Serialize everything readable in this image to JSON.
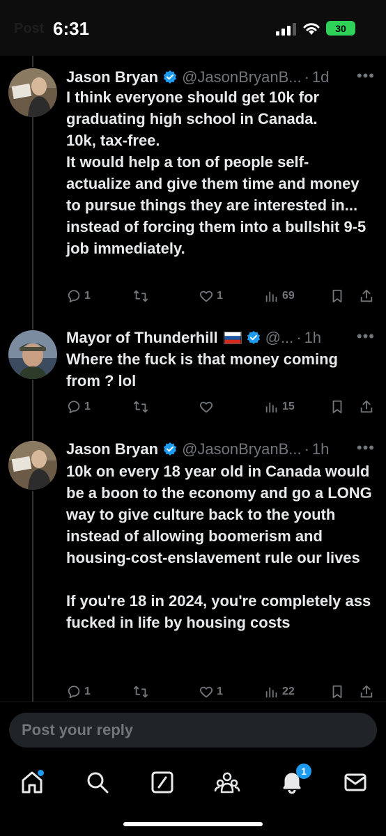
{
  "status_bar": {
    "time": "6:31",
    "battery": "30",
    "ghost_header": "Post"
  },
  "tweets": [
    {
      "name": "Jason Bryan",
      "handle": "@JasonBryanB...",
      "time": "1d",
      "text": "I think everyone should get 10k for graduating high school in Canada.\n10k, tax-free.\nIt would help a ton of people self-actualize and give them time and money to pursue things they are interested in... instead of forcing them into a bullshit 9-5 job immediately.",
      "replies": "1",
      "reposts": "",
      "likes": "1",
      "views": "69"
    },
    {
      "name": "Mayor of Thunderhill",
      "handle": "@...",
      "time": "1h",
      "text": "Where the fuck is that money coming from ? lol",
      "replies": "1",
      "reposts": "",
      "likes": "",
      "views": "15"
    },
    {
      "name": "Jason Bryan",
      "handle": "@JasonBryanB...",
      "time": "1h",
      "text": "10k on every 18 year old in Canada would be a boon to the economy and go a LONG way to give culture back to the youth instead of allowing boomerism and housing-cost-enslavement rule our lives\n\nIf you're 18 in 2024, you're completely ass fucked in life by housing costs",
      "replies": "1",
      "reposts": "",
      "likes": "1",
      "views": "22"
    }
  ],
  "reply": {
    "placeholder": "Post your reply"
  },
  "tabs": {
    "notifications_badge": "1"
  },
  "colors": {
    "accent": "#1d9bf0",
    "muted": "#71767b",
    "text": "#e7e9ea"
  }
}
